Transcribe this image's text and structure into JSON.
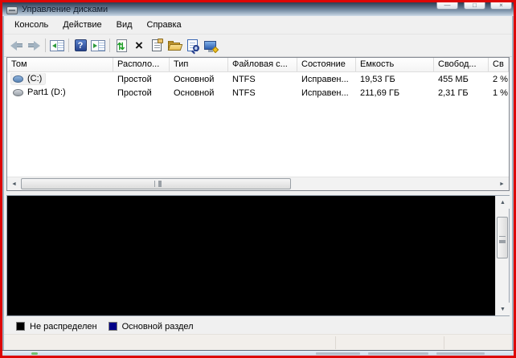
{
  "window": {
    "title": "Управление дисками",
    "controls": {
      "minimize": "—",
      "maximize": "□",
      "close": "×"
    }
  },
  "menu": {
    "items": [
      "Консоль",
      "Действие",
      "Вид",
      "Справка"
    ]
  },
  "toolbar": {
    "icons": [
      "back-icon",
      "forward-icon",
      "show-console-tree-icon",
      "help-icon",
      "show-action-pane-icon",
      "refresh-icon",
      "delete-icon",
      "properties-icon",
      "open-folder-icon",
      "view-icon",
      "computer-management-icon"
    ],
    "help_glyph": "?"
  },
  "volume_list": {
    "columns": [
      "Том",
      "Располо...",
      "Тип",
      "Файловая с...",
      "Состояние",
      "Емкость",
      "Свобод...",
      "Св"
    ],
    "rows": [
      {
        "volume": "(C:)",
        "layout": "Простой",
        "type": "Основной",
        "fs": "NTFS",
        "status": "Исправен...",
        "capacity": "19,53 ГБ",
        "free": "455 МБ",
        "free_pct": "2 %"
      },
      {
        "volume": "Part1 (D:)",
        "layout": "Простой",
        "type": "Основной",
        "fs": "NTFS",
        "status": "Исправен...",
        "capacity": "211,69 ГБ",
        "free": "2,31 ГБ",
        "free_pct": "1 %"
      }
    ]
  },
  "scrollbar": {
    "left_arrow": "◄",
    "right_arrow": "►",
    "up_arrow": "▲",
    "down_arrow": "▼"
  },
  "legend": {
    "items": [
      {
        "label": "Не распределен",
        "color": "#000000"
      },
      {
        "label": "Основной раздел",
        "color": "#000088"
      }
    ]
  },
  "colors": {
    "annotation_border": "#dd0606",
    "unallocated": "#000000",
    "primary_partition": "#000088",
    "titlebar_top": "#2e3d51",
    "titlebar_bottom": "#cfdce9"
  }
}
